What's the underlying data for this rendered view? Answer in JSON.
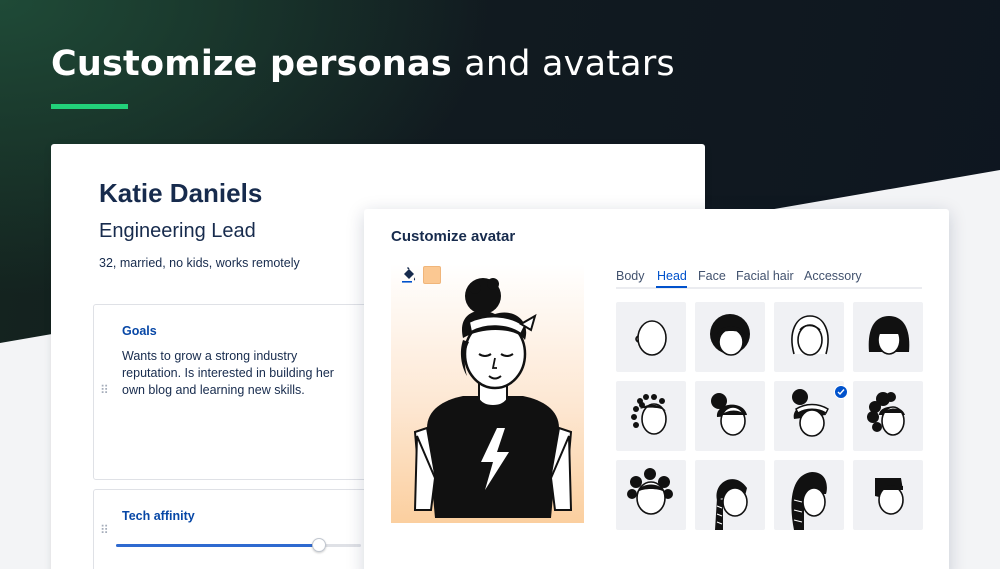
{
  "headline": {
    "bold": "Customize personas",
    "light": "and avatars"
  },
  "colors": {
    "accent": "#22d17a",
    "brand_blue": "#0052cc",
    "swatch": "#fbc892"
  },
  "persona": {
    "name": "Katie Daniels",
    "role": "Engineering Lead",
    "meta": "32, married, no kids, works remotely",
    "goals": {
      "title": "Goals",
      "text": "Wants to grow a strong industry reputation. Is interested in building her own blog and learning new skills."
    },
    "tech_affinity": {
      "title": "Tech affinity",
      "level": 0.83
    }
  },
  "avatar_customizer": {
    "title": "Customize avatar",
    "tabs": [
      {
        "label": "Body"
      },
      {
        "label": "Head"
      },
      {
        "label": "Face"
      },
      {
        "label": "Facial hair"
      },
      {
        "label": "Accessory"
      }
    ],
    "active_tab": "Head",
    "options": [
      {
        "name": "bald"
      },
      {
        "name": "afro-bangs"
      },
      {
        "name": "long-outline"
      },
      {
        "name": "bob-bangs"
      },
      {
        "name": "twists"
      },
      {
        "name": "bun-top"
      },
      {
        "name": "bandana-bun",
        "selected": true
      },
      {
        "name": "curly-puffs"
      },
      {
        "name": "space-buns"
      },
      {
        "name": "braided-side"
      },
      {
        "name": "braids-long"
      },
      {
        "name": "flat-top"
      }
    ]
  }
}
